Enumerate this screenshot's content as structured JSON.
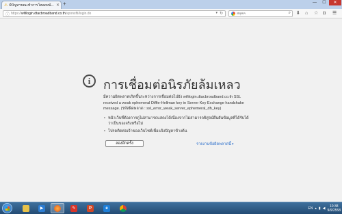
{
  "browser": {
    "tab_title": "มีปัญหาขณะทำการโหลดหน้...",
    "new_tab_label": "+",
    "window_controls": {
      "min": "—",
      "max": "☐",
      "close": "✕"
    }
  },
  "nav": {
    "url_scheme": "https://",
    "url_host": "wifilogin.dtacbroadband.co.th",
    "url_path": "/sponsfti/login.do",
    "search_placeholder": "สลุคค"
  },
  "error_page": {
    "title": "การเชื่อมต่อนิรภัยล้มเหลว",
    "description": "มีความผิดพลาดเกิดขึ้นระหว่างการเชื่อมต่อไปยัง wifilogin.dtacbroadband.co.th SSL received a weak ephemeral Diffie-Hellman key in Server Key Exchange handshake message. (รหัสผิดพลาด : ssl_error_weak_server_ephemeral_dh_key)",
    "bullets": [
      "หน้าเว็บที่ต้องการดูไม่สามารถแสดงได้เนื่องจากไม่สามารถพิสูจน์ยืนยันข้อมูลที่ได้รับได้ว่าเป็นของจริงหรือไม่",
      "โปรดติดต่อเจ้าของเว็บไซต์เพื่อแจ้งปัญหาข้างต้น"
    ],
    "retry_button": "ลองอีกครั้ง",
    "advanced_link": "รายงานข้อผิดพลาดนี้",
    "info_icon_glyph": "i"
  },
  "taskbar": {
    "language": "EN",
    "time": "10:38",
    "date": "9/9/2558"
  },
  "colors": {
    "link": "#2a6ecb",
    "taskbar": "#244c74",
    "page_bg": "#f1f1f1"
  }
}
